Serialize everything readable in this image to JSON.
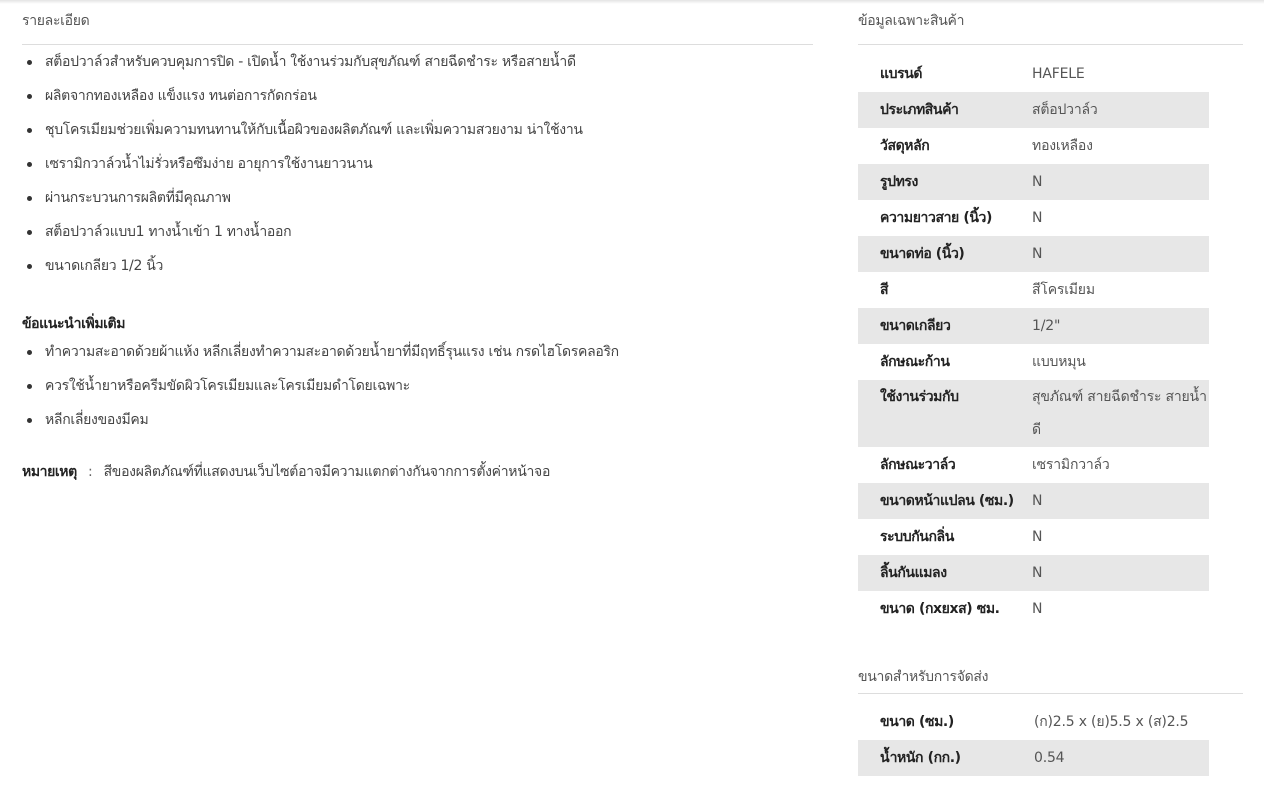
{
  "details": {
    "title": "รายละเอียด",
    "bullets": [
      "สต็อปวาล์วสำหรับควบคุมการปิด - เปิดน้ำ ใช้งานร่วมกับสุขภัณฑ์ สายฉีดชำระ หรือสายน้ำดี",
      "ผลิตจากทองเหลือง แข็งแรง ทนต่อการกัดกร่อน",
      "ชุบโครเมียมช่วยเพิ่มความทนทานให้กับเนื้อผิวของผลิตภัณฑ์ และเพิ่มความสวยงาม น่าใช้งาน",
      "เซรามิกวาล์วน้ำไม่รั่วหรือซึมง่าย อายุการใช้งานยาวนาน",
      "ผ่านกระบวนการผลิตที่มีคุณภาพ",
      "สต็อปวาล์วแบบ1 ทางน้ำเข้า 1 ทางน้ำออก",
      "ขนาดเกลียว 1/2 นิ้ว"
    ],
    "care_title": "ข้อแนะนำเพิ่มเติม",
    "care_bullets": [
      "ทำความสะอาดด้วยผ้าแห้ง หลีกเลี่ยงทำความสะอาดด้วยน้ำยาที่มีฤทธิ์รุนแรง เช่น กรดไฮโดรคลอริก",
      "ควรใช้น้ำยาหรือครีมขัดผิวโครเมียมและโครเมียมดำโดยเฉพาะ",
      "หลีกเลี่ยงของมีคม"
    ],
    "note_label": "หมายเหตุ",
    "note_sep": ":",
    "note_text": "สีของผลิตภัณฑ์ที่แสดงบนเว็บไซต์อาจมีความแตกต่างกันจากการตั้งค่าหน้าจอ"
  },
  "specs": {
    "title": "ข้อมูลเฉพาะสินค้า",
    "rows": [
      {
        "label": "แบรนด์",
        "value": "HAFELE"
      },
      {
        "label": "ประเภทสินค้า",
        "value": "สต็อปวาล์ว"
      },
      {
        "label": "วัสดุหลัก",
        "value": "ทองเหลือง"
      },
      {
        "label": "รูปทรง",
        "value": "N"
      },
      {
        "label": "ความยาวสาย (นิ้ว)",
        "value": "N"
      },
      {
        "label": "ขนาดท่อ (นิ้ว)",
        "value": "N"
      },
      {
        "label": "สี",
        "value": "สีโครเมียม"
      },
      {
        "label": "ขนาดเกลียว",
        "value": "1/2\""
      },
      {
        "label": "ลักษณะก้าน",
        "value": "แบบหมุน"
      },
      {
        "label": "ใช้งานร่วมกับ",
        "value": "สุขภัณฑ์ สายฉีดชำระ สายน้ำดี"
      },
      {
        "label": "ลักษณะวาล์ว",
        "value": "เซรามิกวาล์ว"
      },
      {
        "label": "ขนาดหน้าแปลน (ซม.)",
        "value": "N"
      },
      {
        "label": "ระบบกันกลิ่น",
        "value": "N"
      },
      {
        "label": "ลิ้นกันแมลง",
        "value": "N"
      },
      {
        "label": "ขนาด (กxยxส) ซม.",
        "value": "N"
      }
    ]
  },
  "shipping": {
    "title": "ขนาดสำหรับการจัดส่ง",
    "rows": [
      {
        "label": "ขนาด (ซม.)",
        "value": "(ก)2.5 x (ย)5.5 x (ส)2.5"
      },
      {
        "label": "น้ำหนัก (กก.)",
        "value": "0.54"
      }
    ]
  }
}
